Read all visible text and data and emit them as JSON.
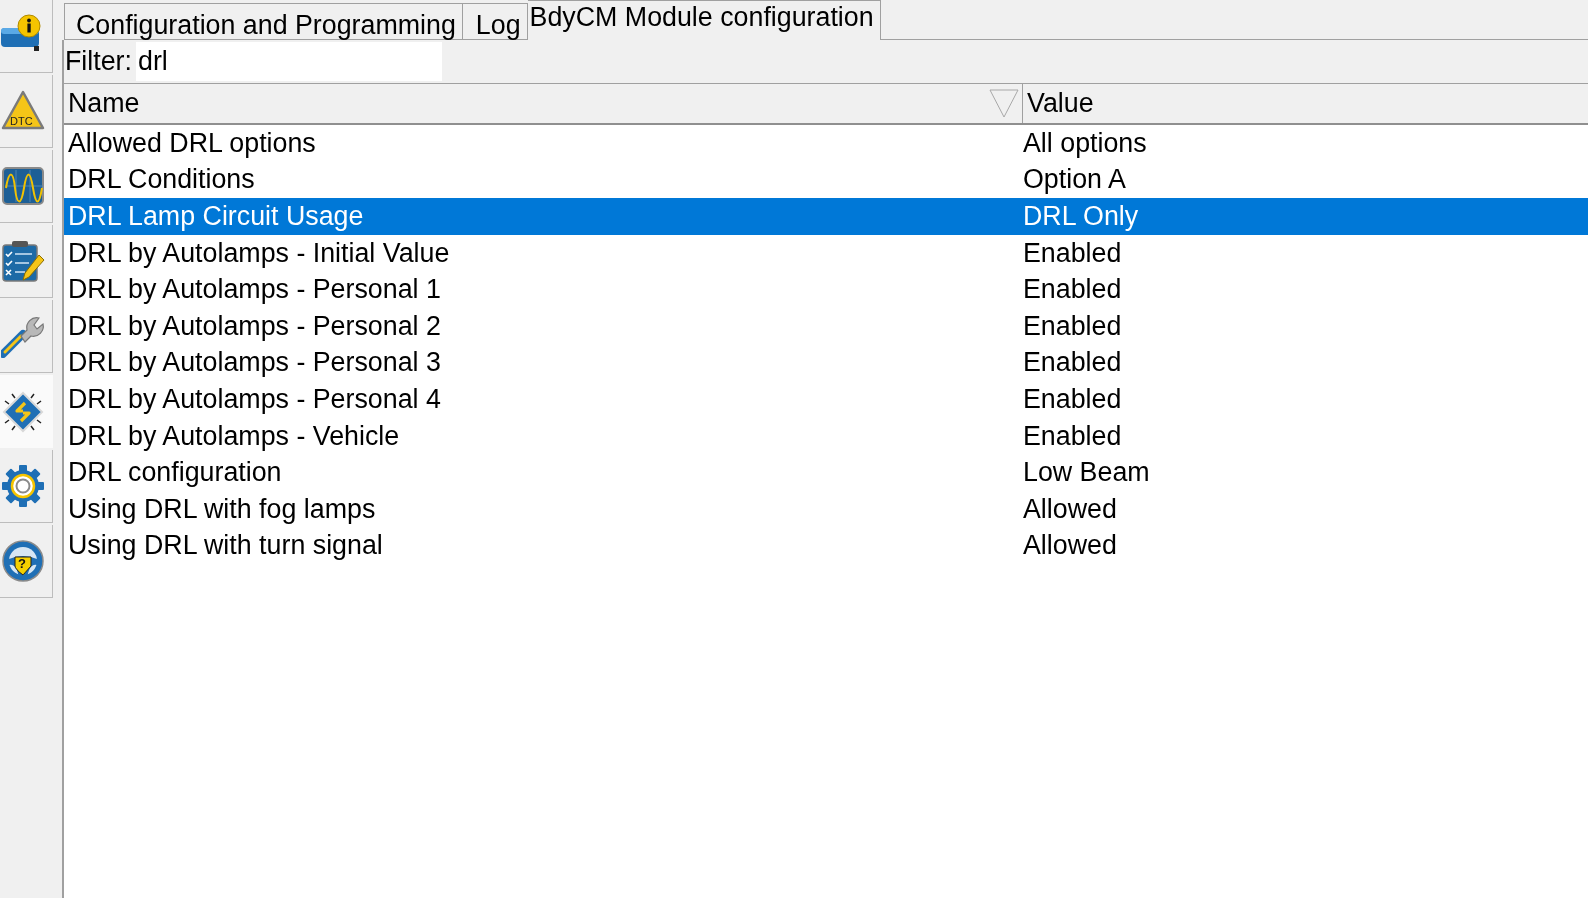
{
  "sidebar": {
    "items": [
      {
        "kind": "info",
        "selected": false
      },
      {
        "kind": "dtc",
        "label": "DTC",
        "selected": false
      },
      {
        "kind": "scope",
        "selected": false
      },
      {
        "kind": "checklist",
        "selected": false
      },
      {
        "kind": "wrench",
        "selected": false
      },
      {
        "kind": "chip",
        "selected": true
      },
      {
        "kind": "gear",
        "selected": false
      },
      {
        "kind": "wheel",
        "label": "?",
        "selected": false
      }
    ]
  },
  "tabs": [
    {
      "label": "Configuration and Programming",
      "selected": false
    },
    {
      "label": "Log",
      "selected": false
    },
    {
      "label": "BdyCM Module configuration",
      "selected": true
    }
  ],
  "filter": {
    "label": "Filter:",
    "value": "drl"
  },
  "table": {
    "columns": [
      {
        "label": "Name",
        "sorted": true
      },
      {
        "label": "Value",
        "sorted": false
      }
    ],
    "rows": [
      {
        "name": "Allowed DRL options",
        "value": "All options",
        "selected": false
      },
      {
        "name": "DRL Conditions",
        "value": "Option A",
        "selected": false
      },
      {
        "name": "DRL Lamp Circuit Usage",
        "value": "DRL Only",
        "selected": true
      },
      {
        "name": "DRL by Autolamps - Initial Value",
        "value": "Enabled",
        "selected": false
      },
      {
        "name": "DRL by Autolamps - Personal 1",
        "value": "Enabled",
        "selected": false
      },
      {
        "name": "DRL by Autolamps - Personal 2",
        "value": "Enabled",
        "selected": false
      },
      {
        "name": "DRL by Autolamps - Personal 3",
        "value": "Enabled",
        "selected": false
      },
      {
        "name": "DRL by Autolamps - Personal 4",
        "value": "Enabled",
        "selected": false
      },
      {
        "name": "DRL by Autolamps - Vehicle",
        "value": "Enabled",
        "selected": false
      },
      {
        "name": "DRL configuration",
        "value": "Low Beam",
        "selected": false
      },
      {
        "name": "Using DRL with fog lamps",
        "value": "Allowed",
        "selected": false
      },
      {
        "name": "Using DRL with turn signal",
        "value": "Allowed",
        "selected": false
      }
    ]
  }
}
